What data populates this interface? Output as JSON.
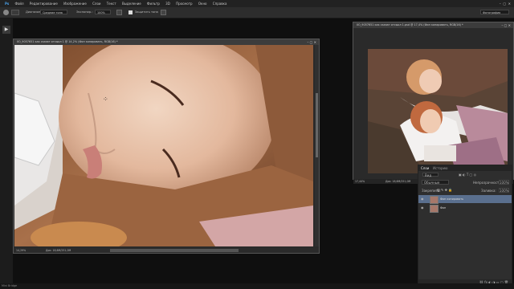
{
  "menubar": {
    "items": [
      "Файл",
      "Редактирование",
      "Изображение",
      "Слои",
      "Текст",
      "Выделение",
      "Фильтр",
      "3D",
      "Просмотр",
      "Окно",
      "Справка"
    ]
  },
  "options_bar": {
    "mode_label": "Диапазон:",
    "mode_value": "Средние тона",
    "exposure_label": "Экспонир.:",
    "exposure_value": "100%",
    "protect_label": "Защитить тона",
    "workspace_value": "Фотография"
  },
  "main_document": {
    "title": "IlO_9057651 как сказат отсыол 1 @ 14,2% (Фон копировать, RGB/16) *",
    "zoom": "14,29%",
    "doc_info": "Док: 18,6М/251,0М"
  },
  "preview_document": {
    "title": "IlO_9057651 как сказат отсыол 1.psd @ 17,4% (Фон копировать, RGB/16) *",
    "zoom": "17,44%",
    "doc_info": "Док: 18,6М/251,0М"
  },
  "layers_panel": {
    "tabs": [
      "Слои",
      "Историю"
    ],
    "search_label": "Вид",
    "blend_mode": "Обычные",
    "opacity_label": "Непрозрачность:",
    "opacity_value": "100%",
    "lock_label": "Закрепить:",
    "fill_label": "Заливка:",
    "fill_value": "100%",
    "layers": [
      {
        "name": "Фон копировать",
        "selected": true
      },
      {
        "name": "Фон",
        "selected": false
      }
    ]
  },
  "bottom_bar": {
    "text": "Mini Bridge"
  },
  "colors": {
    "accent_selected_layer": "#5a6f8e",
    "background": "#0f0f0f"
  }
}
